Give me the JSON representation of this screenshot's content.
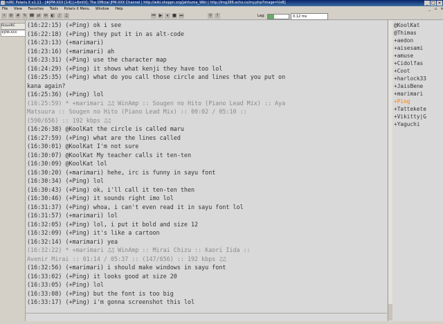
{
  "window": {
    "title": "mIRC Polaris X v1.11 - [#JPM-XXX [14] [+6mtV]: The Official JPM-XXX Channel | http://wiki.shoppn.org/jahhuma_Wiki | http://img286.echo.cx/my.php?image=UsB]",
    "buttons": [
      "_",
      "□",
      "×"
    ]
  },
  "menu": {
    "items": [
      "File",
      "View",
      "Favorites",
      "Tools",
      "Polaris X Menu",
      "Window",
      "Help"
    ]
  },
  "toolbar": {
    "lag_label": "Lag:",
    "lag_value": "0.12 ms",
    "lag_fraction": 0.3,
    "icons": [
      "connect-icon",
      "options-icon",
      "channels-icon",
      "scripts-icon",
      "addressbook-icon",
      "dcc-icon",
      "chat-icon",
      "colors-icon",
      "notify-icon",
      "music-icon",
      "prev-track-icon",
      "play-icon",
      "pause-icon",
      "stop-icon",
      "next-track-icon",
      "link-icon",
      "help-icon"
    ]
  },
  "tabs": [
    {
      "label": "RizonIRC",
      "active": false
    },
    {
      "label": "#JPM-XXX",
      "active": true
    }
  ],
  "chat": {
    "lines": [
      {
        "ts": "(16:22:15)",
        "text": " (+Ping) ok i see",
        "type": "msg"
      },
      {
        "ts": "(16:22:18)",
        "text": " (+Ping) they put it in as alt-code",
        "type": "msg"
      },
      {
        "ts": "(16:23:13)",
        "text": " (+marimari)",
        "type": "msg"
      },
      {
        "ts": "(16:23:16)",
        "text": " (+marimari) ah",
        "type": "msg"
      },
      {
        "ts": "(16:23:31)",
        "text": " (+Ping) use the character map",
        "type": "msg"
      },
      {
        "ts": "(16:24:29)",
        "text": " (+Ping) it shows what kenji they have too lol",
        "type": "msg"
      },
      {
        "ts": "(16:25:35)",
        "text": " (+Ping) what do you call those circle and lines that you put on",
        "type": "msg"
      },
      {
        "ts": "",
        "text": "kana again?",
        "type": "msg"
      },
      {
        "ts": "(16:25:36)",
        "text": " (+Ping) lol",
        "type": "msg"
      },
      {
        "ts": "(16:25:59)",
        "text": "   * +marimari ♫♫ WinAmp :: Sougen no Hito (Piano Lead Mix) :: Aya",
        "type": "action"
      },
      {
        "ts": "",
        "text": "Matsuura :: Sougen no Hito (Piano Lead Mix) :: 00:02 / 05:10 ::",
        "type": "action"
      },
      {
        "ts": "",
        "text": "(590/656) :: 192 kbps ♫♫",
        "type": "action"
      },
      {
        "ts": "(16:26:38)",
        "text": " @KoolKat the circle is called maru",
        "type": "msg"
      },
      {
        "ts": "(16:27:59)",
        "text": " (+Ping) what are the lines called",
        "type": "msg"
      },
      {
        "ts": "(16:30:01)",
        "text": " @KoolKat I'm not sure",
        "type": "msg"
      },
      {
        "ts": "(16:30:07)",
        "text": " @KoolKat My teacher calls it ten-ten",
        "type": "msg"
      },
      {
        "ts": "(16:30:09)",
        "text": " @KoolKat lol",
        "type": "msg"
      },
      {
        "ts": "(16:30:20)",
        "text": " (+marimari) hehe, irc is funny in sayu font",
        "type": "msg"
      },
      {
        "ts": "(16:30:34)",
        "text": " (+Ping) lol",
        "type": "msg"
      },
      {
        "ts": "(16:30:43)",
        "text": " (+Ping) ok, i'll call it ten-ten then",
        "type": "msg"
      },
      {
        "ts": "(16:30:46)",
        "text": " (+Ping) it sounds right imo lol",
        "type": "msg"
      },
      {
        "ts": "(16:31:37)",
        "text": " (+Ping) whoa, i can't even read it in sayu font lol",
        "type": "msg"
      },
      {
        "ts": "(16:31:57)",
        "text": " (+marimari) lol",
        "type": "msg"
      },
      {
        "ts": "(16:32:05)",
        "text": " (+Ping) lol, i put it bold and size 12",
        "type": "msg"
      },
      {
        "ts": "(16:32:09)",
        "text": " (+Ping) it's like a cartoon",
        "type": "msg"
      },
      {
        "ts": "(16:32:14)",
        "text": " (+marimari) yea",
        "type": "msg"
      },
      {
        "ts": "(16:32:22)",
        "text": "   * +marimari ♫♫ WinAmp :: Mirai Chizu :: Kaori Iida ::",
        "type": "action"
      },
      {
        "ts": "",
        "text": "Avenir Mirai :: 01:14 / 05:37 :: (147/656) :: 192 kbps ♫♫",
        "type": "action"
      },
      {
        "ts": "(16:32:56)",
        "text": " (+marimari) i should make windows in sayu font",
        "type": "msg"
      },
      {
        "ts": "(16:33:02)",
        "text": " (+Ping) it looks good at size 20",
        "type": "msg"
      },
      {
        "ts": "(16:33:05)",
        "text": " (+Ping) lol",
        "type": "msg"
      },
      {
        "ts": "(16:33:08)",
        "text": " (+Ping) but the font is too big",
        "type": "msg"
      },
      {
        "ts": "(16:33:17)",
        "text": " (+Ping) i'm gonna screenshot this lol",
        "type": "msg"
      }
    ]
  },
  "nicklist": {
    "nicks": [
      {
        "label": "@KoolKat",
        "highlight": false
      },
      {
        "label": "@Thimas",
        "highlight": false
      },
      {
        "label": "+aedon",
        "highlight": false
      },
      {
        "label": "+aisesami",
        "highlight": false
      },
      {
        "label": "+amuse",
        "highlight": false
      },
      {
        "label": "+Cidolfas",
        "highlight": false
      },
      {
        "label": "+Coot",
        "highlight": false
      },
      {
        "label": "+harlock33",
        "highlight": false
      },
      {
        "label": "+JaisBene",
        "highlight": false
      },
      {
        "label": "+marimari",
        "highlight": false
      },
      {
        "label": "+Ping",
        "highlight": true
      },
      {
        "label": "+Tattekete",
        "highlight": false
      },
      {
        "label": "+Vikitty|G",
        "highlight": false
      },
      {
        "label": "+Yaguchi",
        "highlight": false
      }
    ]
  },
  "colors": {
    "chat_bg": "#d9d9d9",
    "text": "#333333",
    "action": "#8a8a8a",
    "self_nick": "#ff7a00",
    "titlebar": "#0a246a"
  }
}
